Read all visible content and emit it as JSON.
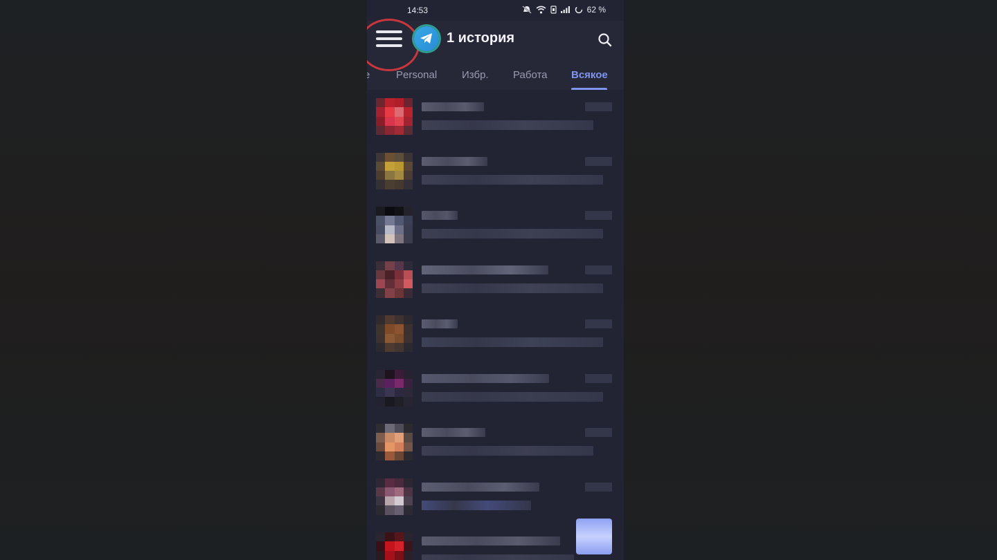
{
  "status_bar": {
    "time": "14:53",
    "battery": "62 %"
  },
  "header": {
    "title": "1 история"
  },
  "tabs": [
    {
      "label": "е",
      "active": false
    },
    {
      "label": "Personal",
      "active": false
    },
    {
      "label": "Избр.",
      "active": false
    },
    {
      "label": "Работа",
      "active": false
    },
    {
      "label": "Всякое",
      "active": true
    }
  ],
  "colors": {
    "accent": "#7f95ee",
    "highlight_ring": "#c9373d",
    "background": "#222433"
  },
  "icons": {
    "menu": "hamburger-menu-icon",
    "logo": "telegram-icon",
    "search": "search-icon",
    "fab": "compose-icon"
  },
  "chats": [
    {
      "avatar": [
        "#6b2630",
        "#b8222c",
        "#b11d28",
        "#6a2530",
        "#a52030",
        "#e63b45",
        "#dc6a72",
        "#b8232d",
        "#8a1e28",
        "#d8354d",
        "#e14550",
        "#a32431",
        "#5d2a33",
        "#8b2633",
        "#a12b35",
        "#5b2c33"
      ],
      "name_w": 90,
      "msg_w": 248,
      "name_c": "#5a5c6e",
      "msg_c": "#3f4154"
    },
    {
      "avatar": [
        "#3e3638",
        "#6b5034",
        "#5c4d3c",
        "#3b3437",
        "#5b4a36",
        "#c4a03a",
        "#b99832",
        "#5a4734",
        "#4c3d2f",
        "#8b7642",
        "#a38a44",
        "#4b3d33",
        "#353034",
        "#4a3d32",
        "#463a30",
        "#33303a"
      ],
      "name_w": 95,
      "msg_w": 262,
      "name_c": "#5c5e70",
      "msg_c": "#3e4053"
    },
    {
      "avatar": [
        "#1b1a20",
        "#0c0b0f",
        "#121116",
        "#24232b",
        "#4a5067",
        "#747892",
        "#525872",
        "#3b3f53",
        "#484c62",
        "#b7b9c8",
        "#6c6f86",
        "#3a3d50",
        "#5b5a6a",
        "#d2c4bb",
        "#7f7680",
        "#3b3c4c"
      ],
      "name_w": 52,
      "msg_w": 262,
      "name_c": "#55576a",
      "msg_c": "#3d3f52"
    },
    {
      "avatar": [
        "#3b2f37",
        "#74404a",
        "#55364a",
        "#2e2b38",
        "#69383f",
        "#4b2128",
        "#7a2f3a",
        "#b94e54",
        "#9d4550",
        "#622f39",
        "#8a3d42",
        "#d05a60",
        "#3d2d35",
        "#824048",
        "#6b3538",
        "#3a2c36"
      ],
      "name_w": 183,
      "msg_w": 262,
      "name_c": "#626479",
      "msg_c": "#3f4154"
    },
    {
      "avatar": [
        "#2f2a2e",
        "#4f3a30",
        "#3e3330",
        "#2c2a30",
        "#3e342e",
        "#7e4a2a",
        "#8b5330",
        "#3a3130",
        "#3d322f",
        "#8a5a36",
        "#7b4d2d",
        "#3b3231",
        "#2d2a2f",
        "#4d3a30",
        "#433530",
        "#2b2a30"
      ],
      "name_w": 52,
      "msg_w": 262,
      "name_c": "#5a5c70",
      "msg_c": "#3e4256"
    },
    {
      "avatar": [
        "#2a2533",
        "#1d1420",
        "#3b1d3a",
        "#262232",
        "#4a2a4a",
        "#5b2060",
        "#7a2a6a",
        "#3a2140",
        "#2d2d45",
        "#3a3550",
        "#2d2840",
        "#2c2a3a",
        "#232230",
        "#1a1820",
        "#202028",
        "#262531"
      ],
      "name_w": 184,
      "msg_w": 262,
      "name_c": "#55586d",
      "msg_c": "#3b3d50"
    },
    {
      "avatar": [
        "#2e2d33",
        "#6c6a76",
        "#4f4d58",
        "#2b2a31",
        "#7d5d4d",
        "#c98a67",
        "#e2a07a",
        "#5a4a45",
        "#6b4a3c",
        "#e59667",
        "#d3805b",
        "#735648",
        "#2b2a31",
        "#9a5a3a",
        "#6c4634",
        "#2b2a31"
      ],
      "name_w": 92,
      "msg_w": 248,
      "name_c": "#5c5e70",
      "msg_c": "#3c3e51"
    },
    {
      "avatar": [
        "#2f2834",
        "#5a2c44",
        "#4a2a3c",
        "#2c2833",
        "#5a3a48",
        "#8a5870",
        "#a06a7e",
        "#4c3442",
        "#3c3440",
        "#b8a6ae",
        "#d4cad2",
        "#4c4250",
        "#2c2933",
        "#5a5260",
        "#686070",
        "#2c2a33"
      ],
      "name_w": 170,
      "msg_w": 158,
      "name_c": "#5b5d71",
      "msg_c": "#434a78"
    },
    {
      "avatar": [
        "#2a2530",
        "#3b1218",
        "#55161c",
        "#2a2430",
        "#3a1018",
        "#c4141e",
        "#d52129",
        "#3c141c",
        "#2b1a20",
        "#a5101a",
        "#7a1016",
        "#2b2028",
        "#262330",
        "#1a1518",
        "#1e1a1f",
        "#282430"
      ],
      "name_w": 200,
      "msg_w": 220,
      "name_c": "#5a5c6e",
      "msg_c": "#3d3f52"
    }
  ]
}
